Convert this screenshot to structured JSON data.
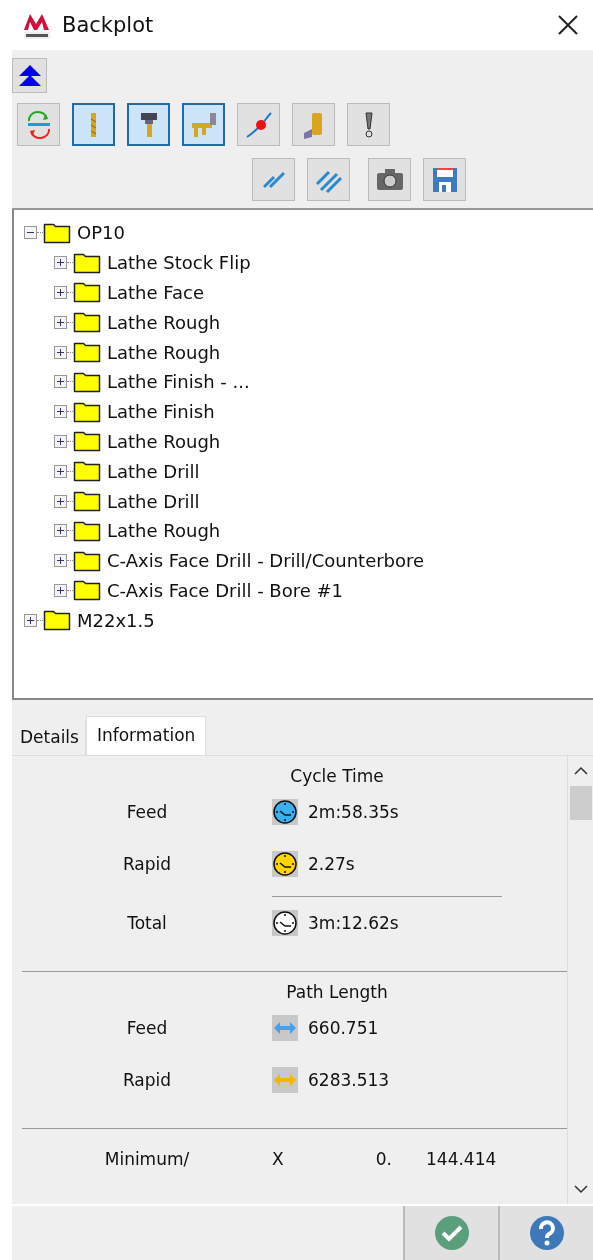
{
  "window": {
    "title": "Backplot"
  },
  "toolbar": {
    "row_1": [
      {
        "kind": "cycle",
        "selected": false
      },
      {
        "kind": "tool",
        "selected": true
      },
      {
        "kind": "holder",
        "selected": true
      },
      {
        "kind": "assembly",
        "selected": true
      },
      {
        "kind": "point",
        "selected": false
      },
      {
        "kind": "stock",
        "selected": false
      },
      {
        "kind": "warning",
        "selected": false
      }
    ],
    "row_2": [
      {
        "kind": "hatch",
        "selected": false
      },
      {
        "kind": "hatch-dense",
        "selected": false
      },
      {
        "kind": "camera",
        "selected": false
      },
      {
        "kind": "save",
        "selected": false
      }
    ]
  },
  "tree": [
    {
      "label": "OP10",
      "expanded": true,
      "children": [
        {
          "label": "Lathe Stock Flip",
          "expanded": false
        },
        {
          "label": "Lathe Face",
          "expanded": false
        },
        {
          "label": "Lathe Rough",
          "expanded": false
        },
        {
          "label": "Lathe Rough",
          "expanded": false
        },
        {
          "label": "Lathe Finish - ...",
          "expanded": false
        },
        {
          "label": "Lathe Finish",
          "expanded": false
        },
        {
          "label": "Lathe Rough",
          "expanded": false
        },
        {
          "label": "Lathe Drill",
          "expanded": false
        },
        {
          "label": "Lathe Drill",
          "expanded": false
        },
        {
          "label": "Lathe Rough",
          "expanded": false
        },
        {
          "label": "C-Axis Face Drill - Drill/Counterbore",
          "expanded": false
        },
        {
          "label": "C-Axis Face Drill - Bore #1",
          "expanded": false
        }
      ]
    },
    {
      "label": "M22x1.5",
      "expanded": false
    }
  ],
  "tabs": [
    {
      "label": "Details",
      "selected": false
    },
    {
      "label": "Information",
      "selected": true
    }
  ],
  "cycle_time": {
    "heading": "Cycle Time",
    "rows": [
      {
        "label": "Feed",
        "kind": "feed",
        "value": "2m:58.35s"
      },
      {
        "label": "Rapid",
        "kind": "rapid",
        "value": "2.27s"
      },
      {
        "label": "Total",
        "kind": "total",
        "value": "3m:12.62s"
      }
    ]
  },
  "path_length": {
    "heading": "Path Length",
    "rows": [
      {
        "label": "Feed",
        "kind": "feed",
        "value": "660.751"
      },
      {
        "label": "Rapid",
        "kind": "rapid",
        "value": "6283.513"
      }
    ]
  },
  "extents": {
    "label": "Minimum/",
    "axis": "X",
    "minimum": "0.",
    "maximum": "144.414"
  }
}
